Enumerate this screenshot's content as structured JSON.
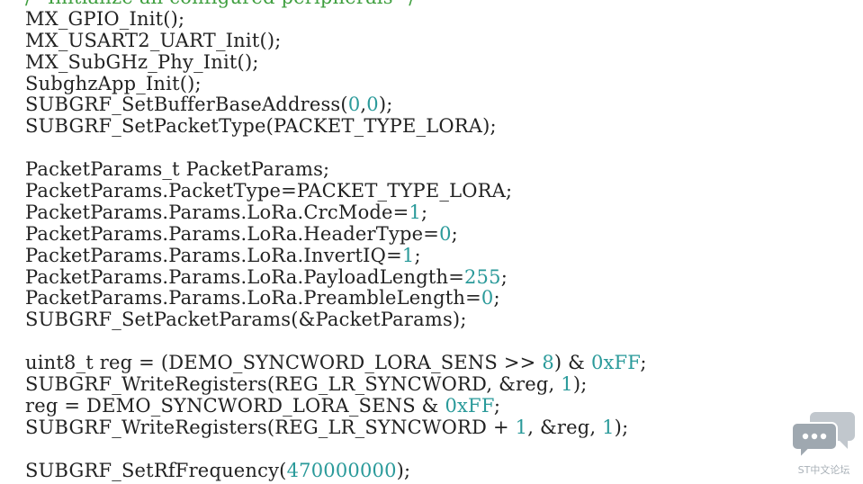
{
  "colors": {
    "background": "#ffffff",
    "text": "#222222",
    "comment": "#3f9f3f",
    "number": "#2a9a9a",
    "watermark": "#9aa3ab"
  },
  "code": {
    "lines": [
      [
        {
          "t": "/* Initialize all configured peripherals */",
          "c": "comment"
        }
      ],
      [
        {
          "t": "MX_GPIO_Init();"
        }
      ],
      [
        {
          "t": "MX_USART2_UART_Init();"
        }
      ],
      [
        {
          "t": "MX_SubGHz_Phy_Init();"
        }
      ],
      [
        {
          "t": "SubghzApp_Init();"
        }
      ],
      [
        {
          "t": "SUBGRF_SetBufferBaseAddress("
        },
        {
          "t": "0",
          "c": "num"
        },
        {
          "t": ","
        },
        {
          "t": "0",
          "c": "num"
        },
        {
          "t": ");"
        }
      ],
      [
        {
          "t": "SUBGRF_SetPacketType(PACKET_TYPE_LORA);"
        }
      ],
      [],
      [
        {
          "t": "PacketParams_t PacketParams;"
        }
      ],
      [
        {
          "t": "PacketParams.PacketType=PACKET_TYPE_LORA;"
        }
      ],
      [
        {
          "t": "PacketParams.Params.LoRa.CrcMode="
        },
        {
          "t": "1",
          "c": "num"
        },
        {
          "t": ";"
        }
      ],
      [
        {
          "t": "PacketParams.Params.LoRa.HeaderType="
        },
        {
          "t": "0",
          "c": "num"
        },
        {
          "t": ";"
        }
      ],
      [
        {
          "t": "PacketParams.Params.LoRa.InvertIQ="
        },
        {
          "t": "1",
          "c": "num"
        },
        {
          "t": ";"
        }
      ],
      [
        {
          "t": "PacketParams.Params.LoRa.PayloadLength="
        },
        {
          "t": "255",
          "c": "num"
        },
        {
          "t": ";"
        }
      ],
      [
        {
          "t": "PacketParams.Params.LoRa.PreambleLength="
        },
        {
          "t": "0",
          "c": "num"
        },
        {
          "t": ";"
        }
      ],
      [
        {
          "t": "SUBGRF_SetPacketParams(&PacketParams);"
        }
      ],
      [],
      [
        {
          "t": "uint8_t reg = (DEMO_SYNCWORD_LORA_SENS >> "
        },
        {
          "t": "8",
          "c": "num"
        },
        {
          "t": ") & "
        },
        {
          "t": "0xFF",
          "c": "num"
        },
        {
          "t": ";"
        }
      ],
      [
        {
          "t": "SUBGRF_WriteRegisters(REG_LR_SYNCWORD, &reg, "
        },
        {
          "t": "1",
          "c": "num"
        },
        {
          "t": ");"
        }
      ],
      [
        {
          "t": "reg = DEMO_SYNCWORD_LORA_SENS & "
        },
        {
          "t": "0xFF",
          "c": "num"
        },
        {
          "t": ";"
        }
      ],
      [
        {
          "t": "SUBGRF_WriteRegisters(REG_LR_SYNCWORD + "
        },
        {
          "t": "1",
          "c": "num"
        },
        {
          "t": ", &reg, "
        },
        {
          "t": "1",
          "c": "num"
        },
        {
          "t": ");"
        }
      ],
      [],
      [
        {
          "t": "SUBGRF_SetRfFrequency("
        },
        {
          "t": "470000000",
          "c": "num"
        },
        {
          "t": ");"
        }
      ]
    ]
  },
  "watermark": {
    "icon": "chat-bubbles-icon",
    "text": "ST中文论坛"
  }
}
